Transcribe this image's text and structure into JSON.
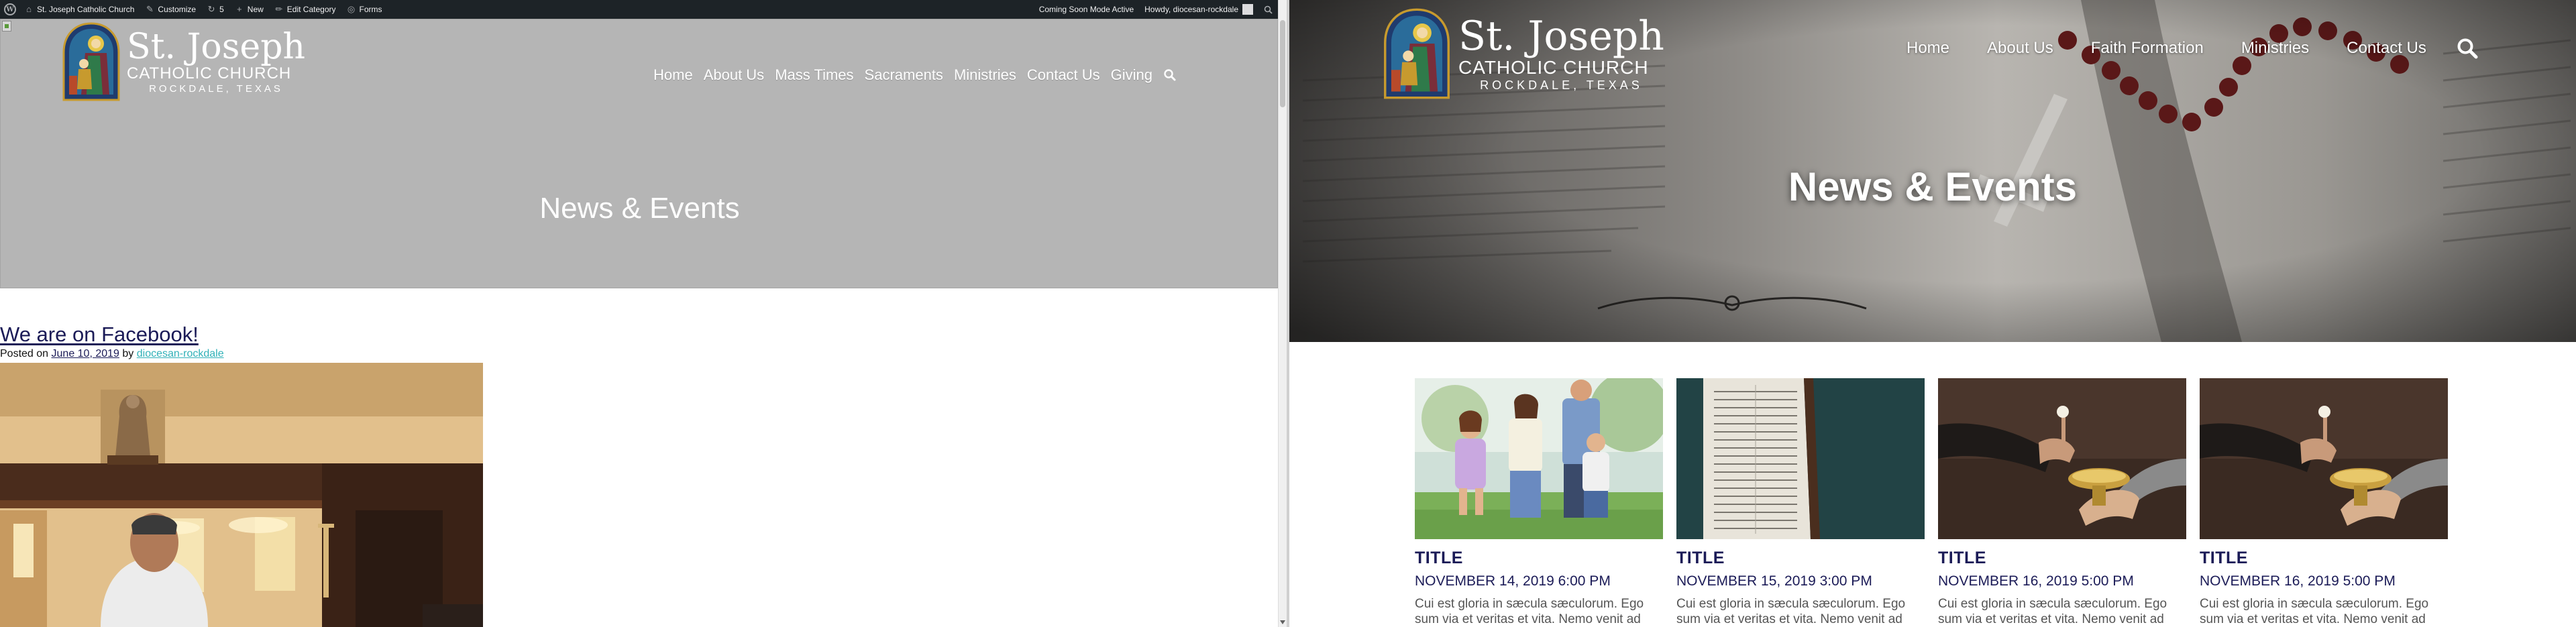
{
  "admin_bar": {
    "site_name": "St. Joseph Catholic Church",
    "customize": "Customize",
    "updates_count": "5",
    "new": "New",
    "edit_category": "Edit Category",
    "forms": "Forms",
    "coming_soon": "Coming Soon Mode Active",
    "howdy": "Howdy, diocesan-rockdale"
  },
  "brand": {
    "name": "St. Joseph",
    "subtitle": "CATHOLIC CHURCH",
    "location": "ROCKDALE, TEXAS"
  },
  "left_nav": [
    {
      "label": "Home"
    },
    {
      "label": "About Us"
    },
    {
      "label": "Mass Times"
    },
    {
      "label": "Sacraments"
    },
    {
      "label": "Ministries"
    },
    {
      "label": "Contact Us"
    },
    {
      "label": "Giving"
    }
  ],
  "right_nav": [
    {
      "label": "Home"
    },
    {
      "label": "About Us"
    },
    {
      "label": "Faith Formation"
    },
    {
      "label": "Ministries"
    },
    {
      "label": "Contact Us"
    }
  ],
  "hero_title": "News & Events",
  "post": {
    "title": "We are on Facebook!",
    "posted_on": "Posted on",
    "date": "June 10, 2019",
    "by": "by",
    "author": "diocesan-rockdale"
  },
  "events": [
    {
      "title": "TITLE",
      "date": "NOVEMBER 14, 2019 6:00 PM",
      "excerpt": "Cui est gloria in sæcula sæculorum. Ego sum via et veritas et vita. Nemo venit ad",
      "image": "family-photo"
    },
    {
      "title": "TITLE",
      "date": "NOVEMBER 15, 2019 3:00 PM",
      "excerpt": "Cui est gloria in sæcula sæculorum. Ego sum via et veritas et vita. Nemo venit ad",
      "image": "bible-photo"
    },
    {
      "title": "TITLE",
      "date": "NOVEMBER 16, 2019 5:00 PM",
      "excerpt": "Cui est gloria in sæcula sæculorum. Ego sum via et veritas et vita. Nemo venit ad",
      "image": "communion-photo"
    },
    {
      "title": "TITLE",
      "date": "NOVEMBER 16, 2019 5:00 PM",
      "excerpt": "Cui est gloria in sæcula sæculorum. Ego sum via et veritas et vita. Nemo venit ad",
      "image": "communion-photo"
    }
  ],
  "colors": {
    "admin_bar": "#1d2327",
    "navy": "#1b1b57",
    "teal_link": "#31b1b8",
    "left_hero_gray": "#b5b5b5"
  }
}
